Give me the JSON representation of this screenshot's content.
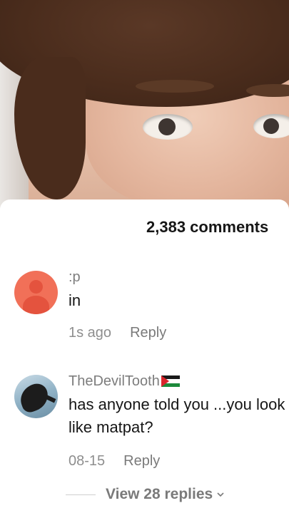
{
  "video": {
    "description_icon": "face-closeup"
  },
  "comments_header": {
    "count_label": "2,383 comments"
  },
  "comments": [
    {
      "username": ":p",
      "text": "in",
      "timestamp": "1s ago",
      "reply_label": "Reply",
      "avatar": "default-avatar-icon"
    },
    {
      "username": "TheDevilTooth",
      "flag": "palestine-flag-icon",
      "text": "has anyone told you ...you look like matpat?",
      "timestamp": "08-15",
      "reply_label": "Reply",
      "avatar": "bird-avatar-icon",
      "view_replies_label": "View 28 replies"
    }
  ],
  "colors": {
    "sheet_bg": "#ffffff",
    "default_avatar": "#f17058",
    "muted_text": "#7d7d7d"
  }
}
